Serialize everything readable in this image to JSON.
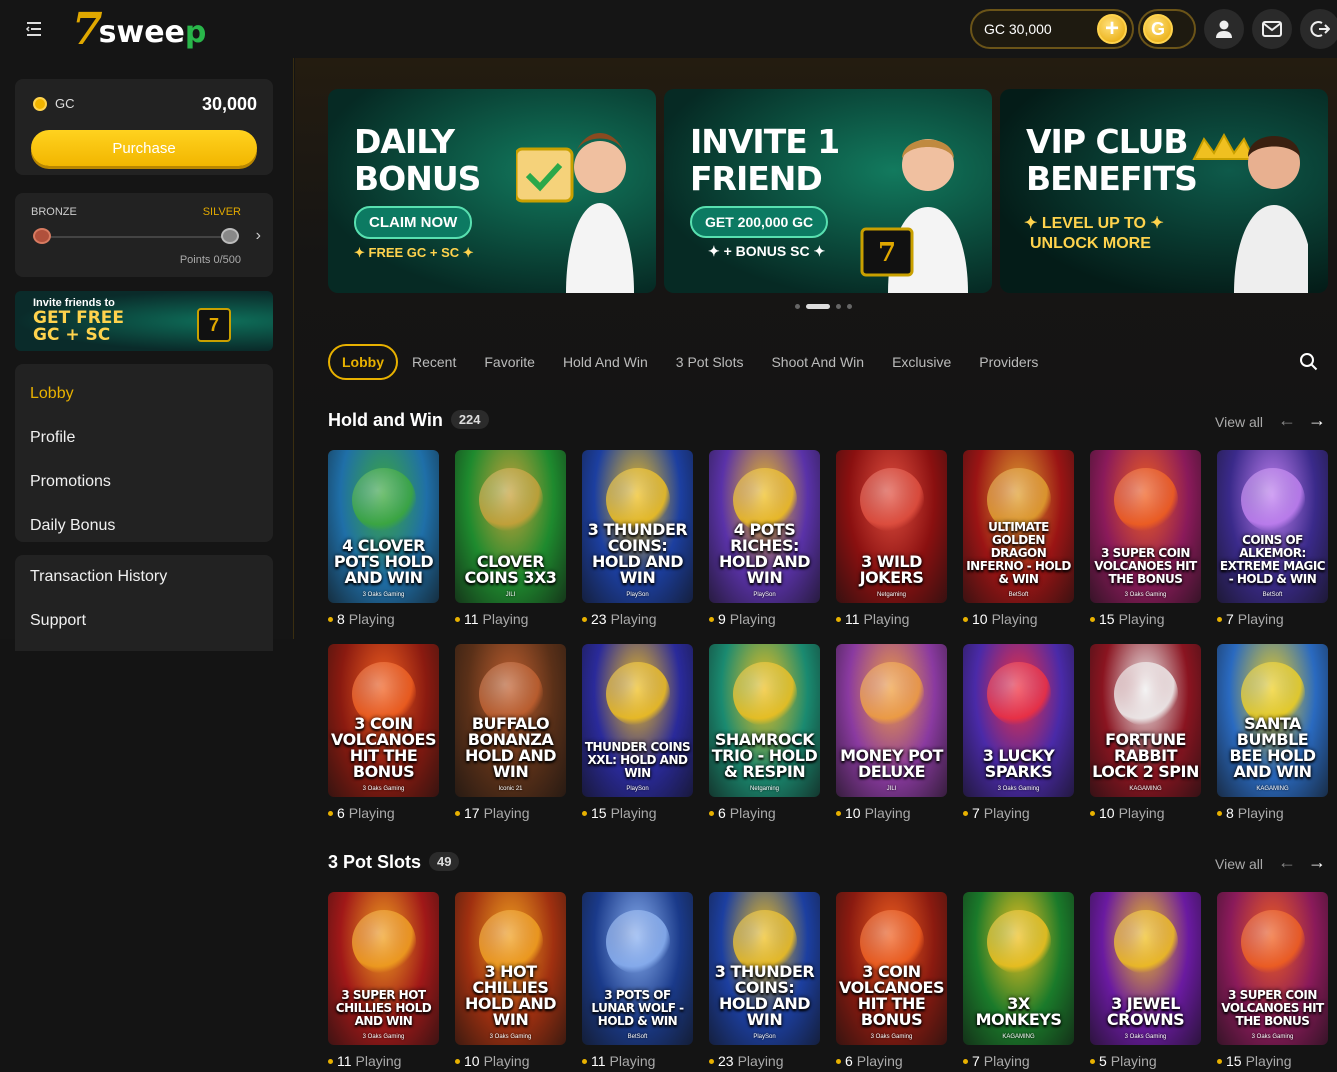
{
  "header": {
    "logo_seven": "7",
    "logo_text": "swee",
    "logo_p": "p",
    "coin_label": "GC 30,000",
    "plus_label": "+",
    "toggle_label": "G"
  },
  "sidebar": {
    "gc_label": "GC",
    "gc_value": "30,000",
    "purchase_label": "Purchase",
    "rank_current": "BRONZE",
    "rank_next": "SILVER",
    "points": "Points 0/500",
    "invite_line1": "Invite friends to",
    "invite_line2": "GET FREE",
    "invite_line3": "GC + SC",
    "nav": [
      {
        "label": "Lobby",
        "active": true
      },
      {
        "label": "Profile"
      },
      {
        "label": "Promotions"
      },
      {
        "label": "Daily Bonus"
      }
    ],
    "nav2": [
      {
        "label": "Transaction History"
      },
      {
        "label": "Support"
      }
    ]
  },
  "banners": [
    {
      "title1": "DAILY",
      "title2": "BONUS",
      "chip": "CLAIM NOW",
      "sub": "✦ FREE GC + SC ✦"
    },
    {
      "title1": "INVITE 1",
      "title2": "FRIEND",
      "chip": "GET 200,000 GC",
      "sub": "✦ + BONUS SC ✦"
    },
    {
      "title1": "VIP CLUB",
      "title2": "BENEFITS",
      "sub1": "✦ LEVEL UP TO ✦",
      "sub2": "UNLOCK MORE"
    }
  ],
  "tabs": [
    "Lobby",
    "Recent",
    "Favorite",
    "Hold And Win",
    "3 Pot Slots",
    "Shoot And Win",
    "Exclusive",
    "Providers"
  ],
  "sections": [
    {
      "title": "Hold and Win",
      "count": "224",
      "view_all": "View all",
      "games": [
        {
          "name": "4 CLOVER POTS HOLD AND WIN",
          "provider": "3 Oaks Gaming",
          "playing": "8",
          "bg": "#1f6fa8",
          "accent": "#3ca83c"
        },
        {
          "name": "CLOVER COINS 3X3",
          "provider": "JILI",
          "playing": "11",
          "bg": "#1e8a2e",
          "accent": "#c9a13a"
        },
        {
          "name": "3 THUNDER COINS: HOLD AND WIN",
          "provider": "PlaySon",
          "playing": "23",
          "bg": "#1c3fa0",
          "accent": "#f0c020"
        },
        {
          "name": "4 POTS RICHES: HOLD AND WIN",
          "provider": "PlaySon",
          "playing": "9",
          "bg": "#5a32a8",
          "accent": "#f0c020"
        },
        {
          "name": "3 WILD JOKERS",
          "provider": "Netgaming",
          "playing": "11",
          "bg": "#8a1010",
          "accent": "#e05040"
        },
        {
          "name": "ULTIMATE GOLDEN DRAGON INFERNO - HOLD & WIN",
          "provider": "BetSoft",
          "playing": "10",
          "bg": "#9a1414",
          "accent": "#e0a030"
        },
        {
          "name": "3 SUPER COIN VOLCANOES HIT THE BONUS",
          "provider": "3 Oaks Gaming",
          "playing": "15",
          "bg": "#8a1a5a",
          "accent": "#f06020"
        },
        {
          "name": "COINS OF ALKEMOR: EXTREME MAGIC - HOLD & WIN",
          "provider": "BetSoft",
          "playing": "7",
          "bg": "#3a2a8a",
          "accent": "#c080f0"
        },
        {
          "name": "3 COIN VOLCANOES HIT THE BONUS",
          "provider": "3 Oaks Gaming",
          "playing": "6",
          "bg": "#8a1a10",
          "accent": "#f06020"
        },
        {
          "name": "BUFFALO BONANZA HOLD AND WIN",
          "provider": "Iconic 21",
          "playing": "17",
          "bg": "#5a3018",
          "accent": "#c06030"
        },
        {
          "name": "THUNDER COINS XXL: HOLD AND WIN",
          "provider": "PlaySon",
          "playing": "15",
          "bg": "#2a2a9a",
          "accent": "#f0c020"
        },
        {
          "name": "SHAMROCK TRIO - HOLD & RESPIN",
          "provider": "Netgaming",
          "playing": "6",
          "bg": "#1a8a70",
          "accent": "#f0c020"
        },
        {
          "name": "MONEY POT DELUXE",
          "provider": "JILI",
          "playing": "10",
          "bg": "#8a3aa0",
          "accent": "#f0a040"
        },
        {
          "name": "3 LUCKY SPARKS",
          "provider": "3 Oaks Gaming",
          "playing": "7",
          "bg": "#4a2aa8",
          "accent": "#f03040"
        },
        {
          "name": "FORTUNE RABBIT LOCK 2 SPIN",
          "provider": "KAGAMING",
          "playing": "10",
          "bg": "#8a1420",
          "accent": "#f0f0f0"
        },
        {
          "name": "SANTA BUMBLE BEE HOLD AND WIN",
          "provider": "KAGAMING",
          "playing": "8",
          "bg": "#2a6ac0",
          "accent": "#f0d020"
        }
      ]
    },
    {
      "title": "3 Pot Slots",
      "count": "49",
      "view_all": "View all",
      "games": [
        {
          "name": "3 SUPER HOT CHILLIES HOLD AND WIN",
          "provider": "3 Oaks Gaming",
          "playing": "11",
          "bg": "#a01818",
          "accent": "#f0a020"
        },
        {
          "name": "3 HOT CHILLIES HOLD AND WIN",
          "provider": "3 Oaks Gaming",
          "playing": "10",
          "bg": "#a03010",
          "accent": "#f0a020"
        },
        {
          "name": "3 POTS OF LUNAR WOLF - HOLD & WIN",
          "provider": "BetSoft",
          "playing": "11",
          "bg": "#1a3a8a",
          "accent": "#8ab0f0"
        },
        {
          "name": "3 THUNDER COINS: HOLD AND WIN",
          "provider": "PlaySon",
          "playing": "23",
          "bg": "#1c3fa0",
          "accent": "#f0c020"
        },
        {
          "name": "3 COIN VOLCANOES HIT THE BONUS",
          "provider": "3 Oaks Gaming",
          "playing": "6",
          "bg": "#8a1a10",
          "accent": "#f06020"
        },
        {
          "name": "3X MONKEYS",
          "provider": "KAGAMING",
          "playing": "7",
          "bg": "#1a7a2a",
          "accent": "#f0c020"
        },
        {
          "name": "3 JEWEL CROWNS",
          "provider": "3 Oaks Gaming",
          "playing": "5",
          "bg": "#6a1aa0",
          "accent": "#f0c020"
        },
        {
          "name": "3 SUPER COIN VOLCANOES HIT THE BONUS",
          "provider": "3 Oaks Gaming",
          "playing": "15",
          "bg": "#8a1a5a",
          "accent": "#f06020"
        }
      ]
    }
  ],
  "playing_suffix": "Playing",
  "colors": {
    "accent": "#e8b100",
    "background": "#141414",
    "card": "#222222"
  }
}
